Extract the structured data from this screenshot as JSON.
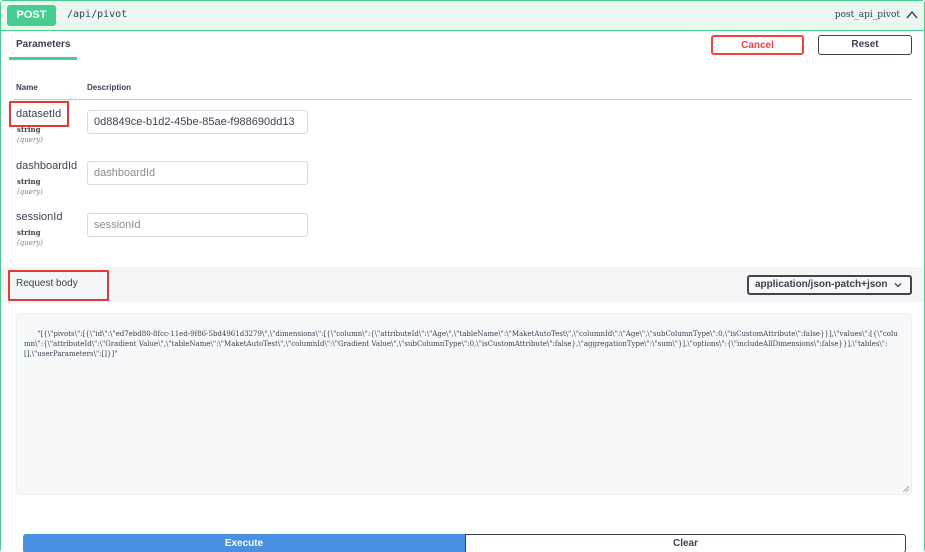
{
  "operation": {
    "method": "POST",
    "path": "/api/pivot",
    "operation_id": "post_api_pivot",
    "method_color": "#49cc90"
  },
  "tabs": {
    "parameters": "Parameters",
    "cancel": "Cancel",
    "reset": "Reset"
  },
  "table_headers": {
    "name": "Name",
    "description": "Description"
  },
  "parameters": [
    {
      "name": "datasetId",
      "type": "string",
      "in": "(query)",
      "value": "0d8849ce-b1d2-45be-85ae-f988690dd13",
      "placeholder": "datasetId"
    },
    {
      "name": "dashboardId",
      "type": "string",
      "in": "(query)",
      "value": "",
      "placeholder": "dashboardId"
    },
    {
      "name": "sessionId",
      "type": "string",
      "in": "(query)",
      "value": "",
      "placeholder": "sessionId"
    }
  ],
  "request_body": {
    "label": "Request body",
    "content_type": "application/json-patch+json",
    "body": "\"[{\\\"pivots\\\":[{\\\"id\\\":\\\"ed7ebd80-8fcc-11ed-9f86-5bd4961d3279\\\",\\\"dimensions\\\":[{\\\"column\\\":{\\\"attributeId\\\":\\\"Age\\\",\\\"tableName\\\":\\\"MaketAutoTest\\\",\\\"columnId\\\":\\\"Age\\\",\\\"subColumnType\\\":0,\\\"isCustomAttribute\\\":false}}],\\\"values\\\":[{\\\"column\\\":{\\\"attributeId\\\":\\\"Gradient Value\\\",\\\"tableName\\\":\\\"MaketAutoTest\\\",\\\"columnId\\\":\\\"Gradient Value\\\",\\\"subColumnType\\\":0,\\\"isCustomAttribute\\\":false},\\\"aggregationType\\\":\\\"sum\\\"}],\\\"options\\\":{\\\"includeAllDimensions\\\":false}}],\\\"tables\\\":[],\\\"userParameters\\\":[]}]\""
  },
  "actions": {
    "execute": "Execute",
    "clear": "Clear"
  },
  "colors": {
    "highlight": "#e53935",
    "execute": "#4990e2",
    "cancel": "#f93e3e"
  }
}
